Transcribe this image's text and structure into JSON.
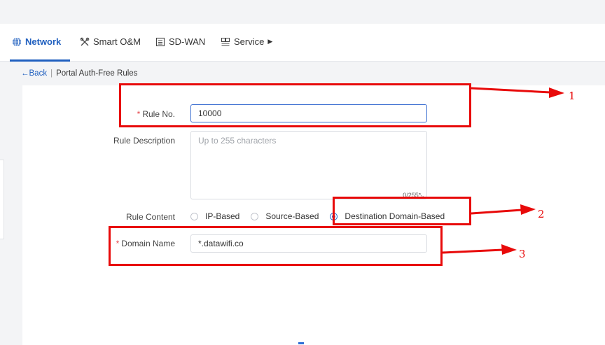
{
  "nav": {
    "items": [
      {
        "label": "Network",
        "icon": "globe-icon",
        "active": true
      },
      {
        "label": "Smart O&M",
        "icon": "tools-icon",
        "active": false
      },
      {
        "label": "SD-WAN",
        "icon": "sdwan-icon",
        "active": false
      },
      {
        "label": "Service",
        "icon": "service-icon",
        "active": false
      }
    ],
    "accent_color": "#1f5fbf"
  },
  "breadcrumb": {
    "back": "←Back",
    "separator": "|",
    "page": "Portal Auth-Free Rules"
  },
  "form": {
    "rule_no": {
      "required_mark": "*",
      "label": "Rule No.",
      "value": "10000"
    },
    "rule_description": {
      "label": "Rule Description",
      "placeholder": "Up to 255 characters",
      "counter": "0/255"
    },
    "rule_content": {
      "label": "Rule Content",
      "options": [
        {
          "label": "IP-Based",
          "checked": false
        },
        {
          "label": "Source-Based",
          "checked": false
        },
        {
          "label": "Destination Domain-Based",
          "checked": true
        }
      ]
    },
    "domain_name": {
      "required_mark": "*",
      "label": "Domain Name",
      "value": "*.datawifi.co"
    }
  },
  "annotations": {
    "labels": [
      "1",
      "2",
      "3"
    ],
    "color": "#e80a0a"
  }
}
